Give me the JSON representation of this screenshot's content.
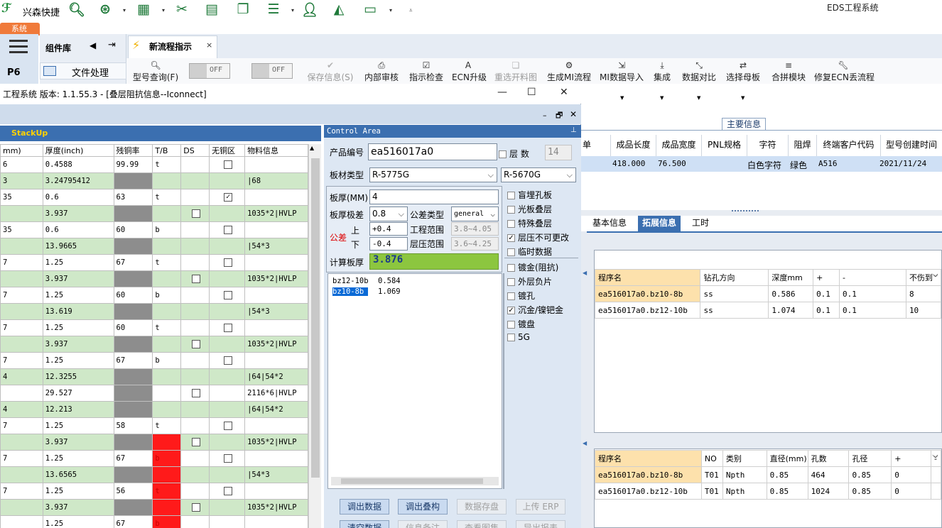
{
  "topbar": {
    "brand": "兴森快捷",
    "app_title": "EDS工程系统",
    "icons": [
      "search-icon",
      "settings-wheel-icon",
      "grid-icon",
      "scissors-icon",
      "film-icon",
      "copy-icon",
      "list-icon",
      "user-icon",
      "chart-icon",
      "monitor-icon",
      "more-icon"
    ]
  },
  "system_tab": "系统",
  "p6_label": "P6",
  "component_library": {
    "title": "组件库",
    "file_processing": "文件处理"
  },
  "doc_tab": {
    "label": "新流程指示",
    "close": "×"
  },
  "ribbon": {
    "model_query": "型号查询(F)",
    "toggle1": "OFF",
    "toggle2": "OFF",
    "save_info": "保存信息(S)",
    "internal_review": "内部审核",
    "instruction_check": "指示检查",
    "ecn_upgrade": "ECN升级",
    "reselect_material": "重选开料图",
    "gen_mi_flow": "生成MI流程",
    "mi_import": "MI数据导入",
    "integrate": "集成",
    "data_compare": "数据对比",
    "select_master": "选择母板",
    "merge_module": "合拼模块",
    "fix_ecn": "修复ECN丢流程"
  },
  "dialog": {
    "title": "工程系统   版本: 1.1.55.3 - [叠层阻抗信息--Iconnect]",
    "minimize": "—",
    "maximize": "☐",
    "close": "✕"
  },
  "stackup": {
    "header": "StackUp",
    "columns": [
      "mm)",
      "厚度(inch)",
      "残铜率",
      "T/B",
      "DS",
      "无铜区",
      "物料信息"
    ],
    "rows": [
      {
        "mm": "6",
        "inch": "0.4588",
        "rate": "99.99",
        "tb": "t",
        "ds": "",
        "nocu": "box",
        "mat": "",
        "green": false,
        "gray": false,
        "red": false
      },
      {
        "mm": "3",
        "inch": "3.24795412",
        "rate": "",
        "tb": "",
        "ds": "",
        "nocu": "",
        "mat": "|68",
        "green": true,
        "gray": true,
        "red": false
      },
      {
        "mm": "35",
        "inch": "0.6",
        "rate": "63",
        "tb": "t",
        "ds": "",
        "nocu": "checked",
        "mat": "",
        "green": false,
        "gray": false,
        "red": false
      },
      {
        "mm": "",
        "inch": "3.937",
        "rate": "",
        "tb": "",
        "ds": "box",
        "nocu": "",
        "mat": "1035*2|HVLP",
        "green": true,
        "gray": true,
        "red": false
      },
      {
        "mm": "35",
        "inch": "0.6",
        "rate": "60",
        "tb": "b",
        "ds": "",
        "nocu": "box",
        "mat": "",
        "green": false,
        "gray": false,
        "red": false
      },
      {
        "mm": "",
        "inch": "13.9665",
        "rate": "",
        "tb": "",
        "ds": "",
        "nocu": "",
        "mat": "|54*3",
        "green": true,
        "gray": true,
        "red": false
      },
      {
        "mm": "7",
        "inch": "1.25",
        "rate": "67",
        "tb": "t",
        "ds": "",
        "nocu": "box",
        "mat": "",
        "green": false,
        "gray": false,
        "red": false
      },
      {
        "mm": "",
        "inch": "3.937",
        "rate": "",
        "tb": "",
        "ds": "box",
        "nocu": "",
        "mat": "1035*2|HVLP",
        "green": true,
        "gray": true,
        "red": false
      },
      {
        "mm": "7",
        "inch": "1.25",
        "rate": "60",
        "tb": "b",
        "ds": "",
        "nocu": "box",
        "mat": "",
        "green": false,
        "gray": false,
        "red": false
      },
      {
        "mm": "",
        "inch": "13.619",
        "rate": "",
        "tb": "",
        "ds": "",
        "nocu": "",
        "mat": "|54*3",
        "green": true,
        "gray": true,
        "red": false
      },
      {
        "mm": "7",
        "inch": "1.25",
        "rate": "60",
        "tb": "t",
        "ds": "",
        "nocu": "box",
        "mat": "",
        "green": false,
        "gray": false,
        "red": false
      },
      {
        "mm": "",
        "inch": "3.937",
        "rate": "",
        "tb": "",
        "ds": "box",
        "nocu": "",
        "mat": "1035*2|HVLP",
        "green": true,
        "gray": true,
        "red": false
      },
      {
        "mm": "7",
        "inch": "1.25",
        "rate": "67",
        "tb": "b",
        "ds": "",
        "nocu": "box",
        "mat": "",
        "green": false,
        "gray": false,
        "red": false
      },
      {
        "mm": "4",
        "inch": "12.3255",
        "rate": "",
        "tb": "",
        "ds": "",
        "nocu": "",
        "mat": "|64|54*2",
        "green": true,
        "gray": true,
        "red": false
      },
      {
        "mm": "",
        "inch": "29.527",
        "rate": "",
        "tb": "",
        "ds": "box",
        "nocu": "",
        "mat": "2116*6|HVLP",
        "green": false,
        "gray": true,
        "red": false
      },
      {
        "mm": "4",
        "inch": "12.213",
        "rate": "",
        "tb": "",
        "ds": "",
        "nocu": "",
        "mat": "|64|54*2",
        "green": true,
        "gray": true,
        "red": false
      },
      {
        "mm": "7",
        "inch": "1.25",
        "rate": "58",
        "tb": "t",
        "ds": "",
        "nocu": "box",
        "mat": "",
        "green": false,
        "gray": false,
        "red": false
      },
      {
        "mm": "",
        "inch": "3.937",
        "rate": "",
        "tb": "",
        "ds": "box",
        "nocu": "",
        "mat": "1035*2|HVLP",
        "green": true,
        "gray": true,
        "red": true
      },
      {
        "mm": "7",
        "inch": "1.25",
        "rate": "67",
        "tb": "b",
        "ds": "",
        "nocu": "box",
        "mat": "",
        "green": false,
        "gray": false,
        "red": true
      },
      {
        "mm": "",
        "inch": "13.6565",
        "rate": "",
        "tb": "",
        "ds": "",
        "nocu": "",
        "mat": "|54*3",
        "green": true,
        "gray": true,
        "red": true
      },
      {
        "mm": "7",
        "inch": "1.25",
        "rate": "56",
        "tb": "t",
        "ds": "",
        "nocu": "box",
        "mat": "",
        "green": false,
        "gray": false,
        "red": true
      },
      {
        "mm": "",
        "inch": "3.937",
        "rate": "",
        "tb": "",
        "ds": "box",
        "nocu": "",
        "mat": "1035*2|HVLP",
        "green": true,
        "gray": true,
        "red": true
      },
      {
        "mm": "",
        "inch": "1.25",
        "rate": "67",
        "tb": "b",
        "ds": "",
        "nocu": "",
        "mat": "",
        "green": false,
        "gray": false,
        "red": true
      }
    ]
  },
  "control": {
    "header": "Control Area",
    "product_no_label": "产品编号",
    "product_no": "ea516017a0",
    "layers_label": "层 数",
    "layers": "14",
    "board_type_label": "板材类型",
    "board_type_1": "R-5775G",
    "board_type_2": "R-5670G",
    "thickness_label": "板厚(MM)",
    "thickness": "4",
    "thk_tol_label": "板厚极差",
    "thk_tol": "0.8",
    "tol_type_label": "公差类型",
    "tol_type": "general",
    "tolerance_label": "公差",
    "upper_label": "上",
    "lower_label": "下",
    "upper": "+0.4",
    "lower": "-0.4",
    "eng_range_label": "工程范围",
    "eng_range": "3.8~4.05",
    "lam_range_label": "层压范围",
    "lam_range": "3.6~4.25",
    "calc_label": "计算板厚",
    "calc": "3.876",
    "options": [
      {
        "label": "盲埋孔板",
        "checked": false
      },
      {
        "label": "光板叠层",
        "checked": false
      },
      {
        "label": "特殊叠层",
        "checked": false
      },
      {
        "label": "层压不可更改",
        "checked": true
      },
      {
        "label": "临时数据",
        "checked": false
      },
      {
        "label": "镀金(阻抗)",
        "checked": false
      },
      {
        "label": "外层负片",
        "checked": false
      },
      {
        "label": "镀孔",
        "checked": false
      },
      {
        "label": "沉金/镍钯金",
        "checked": true
      },
      {
        "label": "镀盘",
        "checked": false
      },
      {
        "label": "5G",
        "checked": false
      }
    ],
    "list": [
      {
        "name": "bz12-10b",
        "val": "0.584",
        "selected": false
      },
      {
        "name": "bz10-8b",
        "val": "1.069",
        "selected": true
      }
    ],
    "buttons": [
      "调出数据",
      "调出叠构",
      "数据存盘",
      "上传 ERP",
      "清空数据",
      "信息备注",
      "查看图集",
      "导出报表"
    ]
  },
  "main_info": {
    "header": "主要信息",
    "columns": [
      "单",
      "成品长度",
      "成品宽度",
      "PNL规格",
      "字符",
      "阻焊",
      "终端客户代码",
      "型号创建时间"
    ],
    "row": [
      "",
      "418.000",
      "76.500",
      "",
      "白色字符",
      "绿色",
      "A516",
      "2021/11/24"
    ]
  },
  "subtabs": [
    "基本信息",
    "拓展信息",
    "工时"
  ],
  "drill_table": {
    "columns": [
      "程序名",
      "钻孔方向",
      "深度mm",
      "+",
      "-",
      "不伤到"
    ],
    "rows": [
      [
        "ea516017a0.bz10-8b",
        "ss",
        "0.586",
        "0.1",
        "0.1",
        "8"
      ],
      [
        "ea516017a0.bz12-10b",
        "ss",
        "1.074",
        "0.1",
        "0.1",
        "10"
      ]
    ]
  },
  "hole_table": {
    "columns": [
      "程序名",
      "NO",
      "类别",
      "直径(mm)",
      "孔数",
      "孔径",
      "+",
      "-"
    ],
    "rows": [
      [
        "ea516017a0.bz10-8b",
        "T01",
        "Npth",
        "0.85",
        "464",
        "0.85",
        "0",
        ""
      ],
      [
        "ea516017a0.bz12-10b",
        "T01",
        "Npth",
        "0.85",
        "1024",
        "0.85",
        "0",
        ""
      ]
    ]
  }
}
